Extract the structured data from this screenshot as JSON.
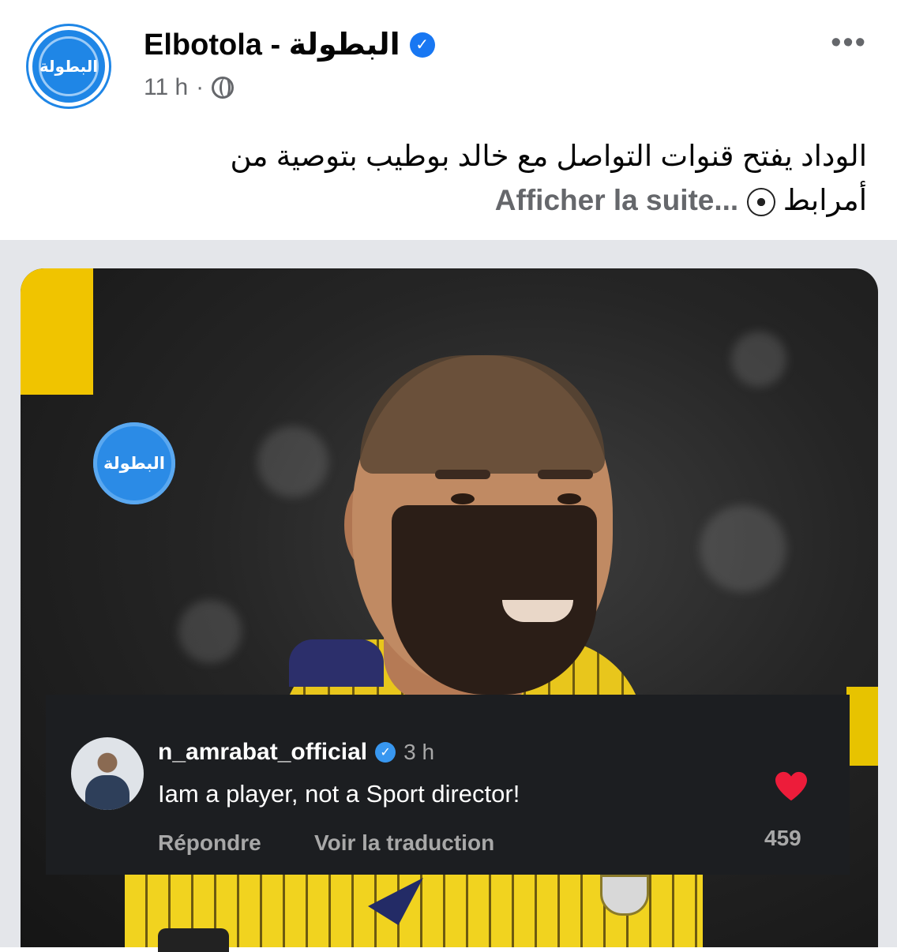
{
  "post": {
    "page_name": "Elbotola - البطولة",
    "avatar_text": "البطولة",
    "time": "11 h",
    "separator": "·",
    "more": "•••",
    "caption_line1": "الوداد يفتح قنوات التواصل مع خالد بوطيب بتوصية من",
    "caption_line2": "أمرابط",
    "see_more": "Afficher la suite..."
  },
  "media": {
    "watermark_text": "البطولة"
  },
  "comment": {
    "username": "n_amrabat_official",
    "time": "3 h",
    "text": "Iam a player, not a Sport director!",
    "reply": "Répondre",
    "translate": "Voir la traduction",
    "likes": "459"
  },
  "icons": {
    "verified": "verified-badge-icon",
    "globe": "globe-icon",
    "ball": "soccer-ball-icon",
    "heart": "heart-icon"
  },
  "colors": {
    "facebook_blue": "#1877f2",
    "brand_blue": "#1f86e6",
    "heart_red": "#ed1c3a",
    "comment_bg": "#1c1e21"
  }
}
